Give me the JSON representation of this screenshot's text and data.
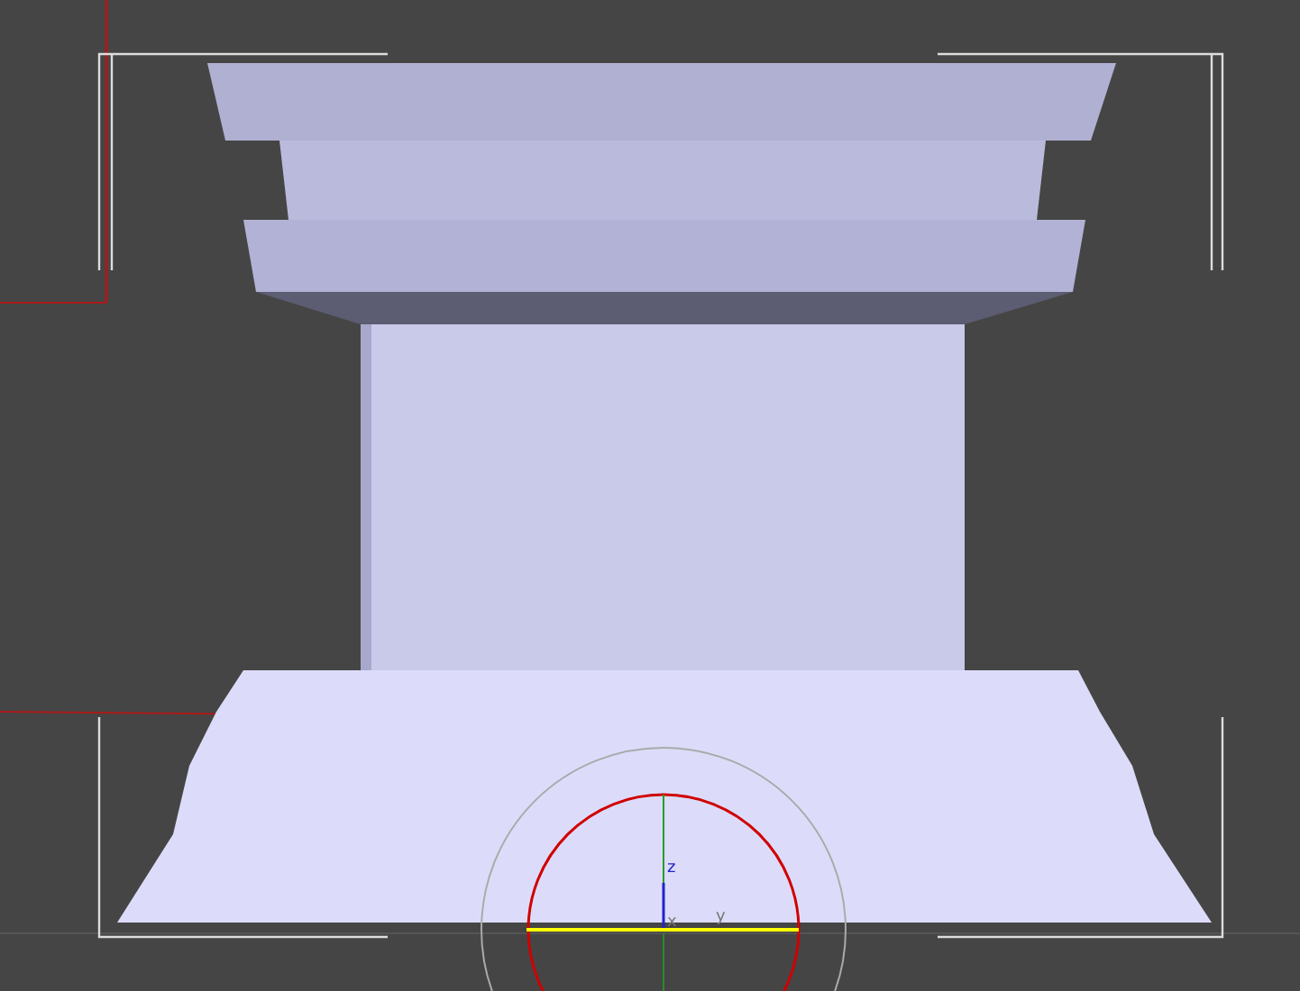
{
  "viewport": {
    "gizmo": {
      "axis_labels": [
        "z",
        "x",
        "y"
      ]
    }
  }
}
